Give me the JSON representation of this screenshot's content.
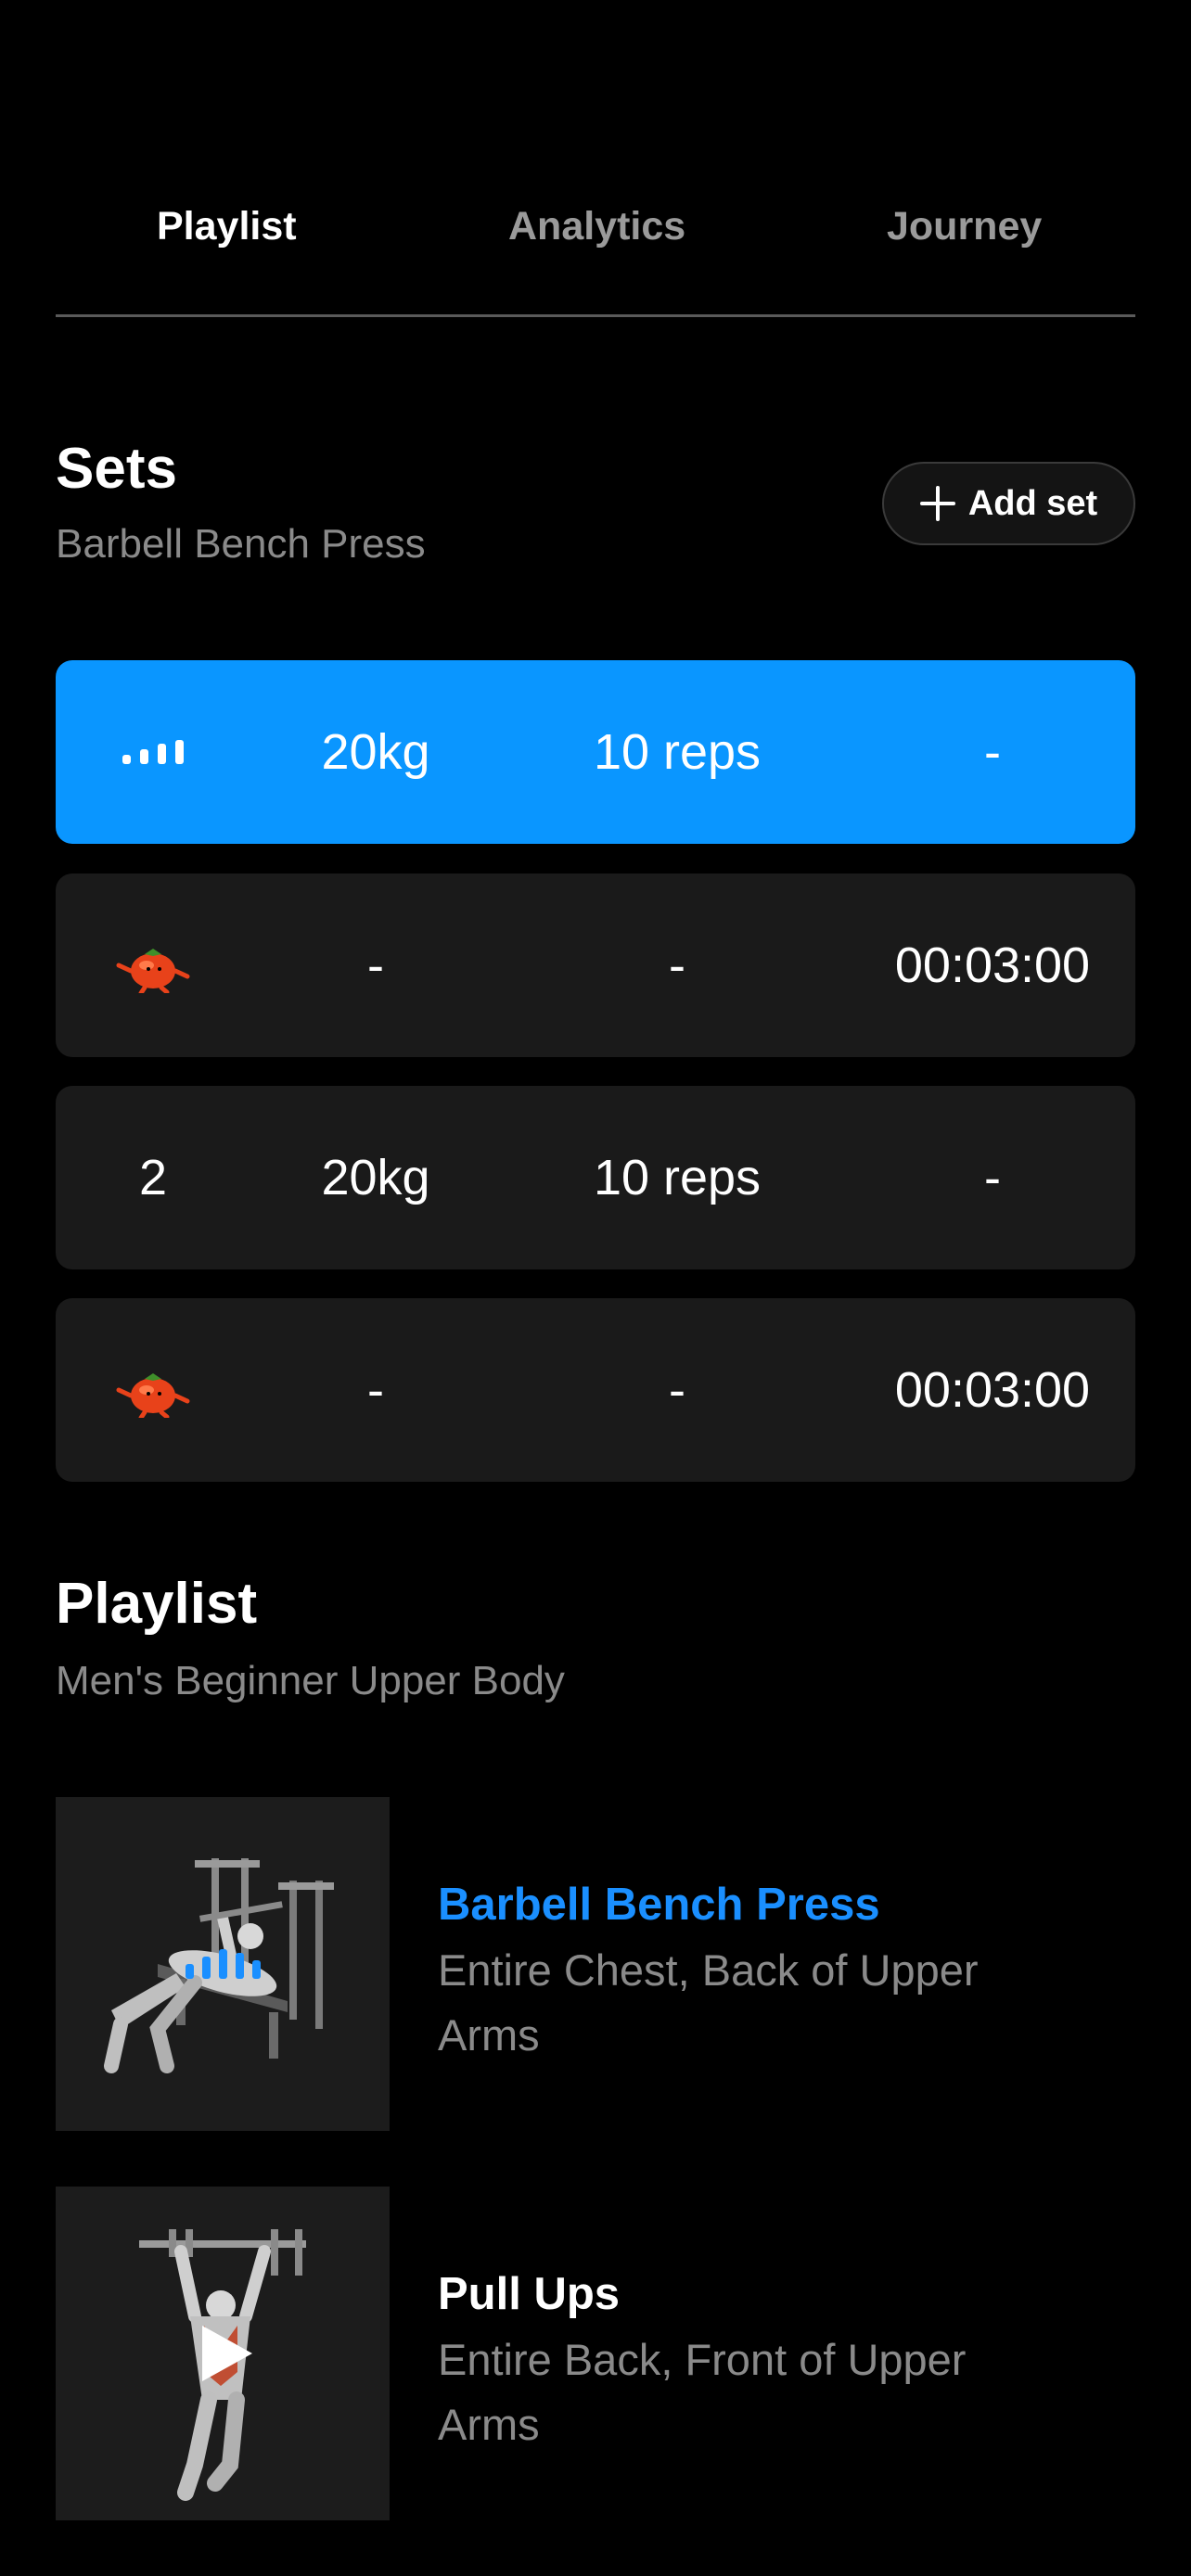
{
  "tabs": [
    {
      "label": "Playlist",
      "active": true
    },
    {
      "label": "Analytics",
      "active": false
    },
    {
      "label": "Journey",
      "active": false
    }
  ],
  "sets_section": {
    "title": "Sets",
    "subtitle": "Barbell Bench Press",
    "add_button": "Add set"
  },
  "sets": [
    {
      "type": "set",
      "index_icon": "loading-bars-icon",
      "weight": "20kg",
      "reps": "10 reps",
      "rest": "-",
      "active": true
    },
    {
      "type": "rest",
      "index_icon": "tomato-icon",
      "weight": "-",
      "reps": "-",
      "rest": "00:03:00",
      "active": false
    },
    {
      "type": "set",
      "index": "2",
      "weight": "20kg",
      "reps": "10 reps",
      "rest": "-",
      "active": false
    },
    {
      "type": "rest",
      "index_icon": "tomato-icon",
      "weight": "-",
      "reps": "-",
      "rest": "00:03:00",
      "active": false
    }
  ],
  "playlist_section": {
    "title": "Playlist",
    "subtitle": "Men's Beginner Upper Body"
  },
  "exercises": [
    {
      "name": "Barbell Bench Press",
      "muscles": "Entire Chest, Back of Upper Arms",
      "current": true,
      "thumb_icon": "bench-press-figure-icon"
    },
    {
      "name": "Pull Ups",
      "muscles": "Entire Back, Front of Upper Arms",
      "current": false,
      "thumb_icon": "pull-up-figure-icon"
    }
  ],
  "colors": {
    "accent": "#0a96ff",
    "accent_text": "#1a8fff",
    "row_bg": "#1a1a1a",
    "muted_text": "#8a8a8a"
  }
}
